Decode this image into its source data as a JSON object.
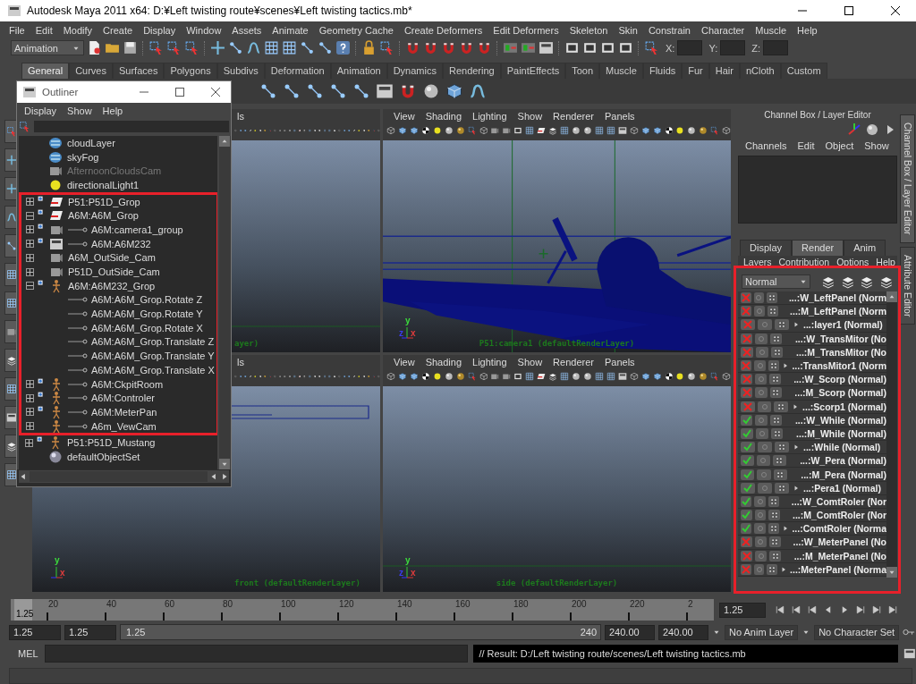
{
  "window": {
    "title": "Autodesk Maya 2011 x64: D:¥Left twisting route¥scenes¥Left twisting tactics.mb*"
  },
  "menu_bar": [
    "File",
    "Edit",
    "Modify",
    "Create",
    "Display",
    "Window",
    "Assets",
    "Animate",
    "Geometry Cache",
    "Create Deformers",
    "Edit Deformers",
    "Skeleton",
    "Skin",
    "Constrain",
    "Character",
    "Muscle",
    "Help"
  ],
  "status_line": {
    "mode": "Animation",
    "fields": [
      {
        "label": "X:"
      },
      {
        "label": "Y:"
      },
      {
        "label": "Z:"
      }
    ]
  },
  "shelf_tabs": [
    {
      "label": "General",
      "selected": true
    },
    {
      "label": "Curves",
      "selected": false
    },
    {
      "label": "Surfaces",
      "selected": false
    },
    {
      "label": "Polygons",
      "selected": false
    },
    {
      "label": "Subdivs",
      "selected": false
    },
    {
      "label": "Deformation",
      "selected": false
    },
    {
      "label": "Animation",
      "selected": false
    },
    {
      "label": "Dynamics",
      "selected": false
    },
    {
      "label": "Rendering",
      "selected": false
    },
    {
      "label": "PaintEffects",
      "selected": false
    },
    {
      "label": "Toon",
      "selected": false
    },
    {
      "label": "Muscle",
      "selected": false
    },
    {
      "label": "Fluids",
      "selected": false
    },
    {
      "label": "Fur",
      "selected": false
    },
    {
      "label": "Hair",
      "selected": false
    },
    {
      "label": "nCloth",
      "selected": false
    },
    {
      "label": "Custom",
      "selected": false
    }
  ],
  "viewports": [
    {
      "menus": [
        "ls"
      ],
      "label": "ayer)",
      "kind": "empty"
    },
    {
      "menus": [
        "View",
        "Shading",
        "Lighting",
        "Show",
        "Renderer",
        "Panels"
      ],
      "label": "P51:camera1 (defaultRenderLayer)",
      "kind": "airplane",
      "axes": [
        {
          "label": "y",
          "color": "#3cdc3c"
        },
        {
          "label": "z",
          "color": "#3c3cf0"
        },
        {
          "label": "x",
          "color": "#e03c3c"
        }
      ]
    },
    {
      "menus": [
        "ls"
      ],
      "label": "front (defaultRenderLayer)",
      "kind": "box",
      "axes": [
        {
          "label": "y",
          "color": "#3cdc3c"
        },
        {
          "label": "x",
          "color": "#e03c3c"
        }
      ]
    },
    {
      "menus": [
        "View",
        "Shading",
        "Lighting",
        "Show",
        "Renderer",
        "Panels"
      ],
      "label": "side (defaultRenderLayer)",
      "kind": "empty",
      "axes": [
        {
          "label": "y",
          "color": "#3cdc3c"
        },
        {
          "label": "z",
          "color": "#3c3cf0"
        },
        {
          "label": "x",
          "color": "#e03c3c"
        }
      ]
    }
  ],
  "outliner": {
    "title": "Outliner",
    "menus": [
      "Display",
      "Show",
      "Help"
    ],
    "items": [
      {
        "label": "cloudLayer",
        "kind": "fluid",
        "flagged": false,
        "dimmed": false
      },
      {
        "label": "skyFog",
        "kind": "fluid",
        "flagged": false,
        "dimmed": false
      },
      {
        "label": "AfternoonCloudsCam",
        "kind": "camera",
        "flagged": false,
        "dimmed": true
      },
      {
        "label": "directionalLight1",
        "kind": "light",
        "flagged": false,
        "dimmed": false
      },
      {
        "label": "P51:P51D_Grop",
        "kind": "transform",
        "expanded": false,
        "flagged": true,
        "dimmed": false
      },
      {
        "label": "A6M:A6M_Grop",
        "kind": "transform",
        "expanded": true,
        "flagged": true,
        "dimmed": false,
        "children": [
          {
            "label": "A6M:camera1_group",
            "kind": "camera",
            "expanded": false,
            "flagged": true,
            "dimmed": false
          },
          {
            "label": "A6M:A6M232",
            "kind": "panel",
            "expanded": false,
            "flagged": true,
            "dimmed": false
          }
        ]
      },
      {
        "label": "A6M_OutSide_Cam",
        "kind": "camera",
        "expanded": false,
        "flagged": false,
        "dimmed": false
      },
      {
        "label": "P51D_OutSide_Cam",
        "kind": "camera",
        "expanded": false,
        "flagged": false,
        "dimmed": false
      },
      {
        "label": "A6M:A6M232_Grop",
        "kind": "figure",
        "expanded": true,
        "flagged": true,
        "dimmed": false,
        "children": [
          {
            "label": "A6M:A6M_Grop.Rotate Z",
            "kind": "none",
            "flagged": false,
            "dimmed": false
          },
          {
            "label": "A6M:A6M_Grop.Rotate Y",
            "kind": "none",
            "flagged": false,
            "dimmed": false
          },
          {
            "label": "A6M:A6M_Grop.Rotate X",
            "kind": "none",
            "flagged": false,
            "dimmed": false
          },
          {
            "label": "A6M:A6M_Grop.Translate Z",
            "kind": "none",
            "flagged": false,
            "dimmed": false
          },
          {
            "label": "A6M:A6M_Grop.Translate Y",
            "kind": "none",
            "flagged": false,
            "dimmed": false
          },
          {
            "label": "A6M:A6M_Grop.Translate X",
            "kind": "none",
            "flagged": false,
            "dimmed": false
          },
          {
            "label": "A6M:CkpitRoom",
            "kind": "figure",
            "expanded": false,
            "flagged": true,
            "dimmed": false
          },
          {
            "label": "A6M:Controler",
            "kind": "figure",
            "expanded": false,
            "flagged": true,
            "dimmed": false
          },
          {
            "label": "A6M:MeterPan",
            "kind": "figure",
            "expanded": false,
            "flagged": true,
            "dimmed": false
          },
          {
            "label": "A6m_VewCam",
            "kind": "figure",
            "expanded": false,
            "flagged": false,
            "dimmed": false
          }
        ]
      },
      {
        "label": "P51:P51D_Mustang",
        "kind": "figure",
        "expanded": false,
        "flagged": true,
        "dimmed": false
      },
      {
        "label": "defaultObjectSet",
        "kind": "set",
        "flagged": false,
        "dimmed": false
      }
    ]
  },
  "channel_box": {
    "title": "Channel Box / Layer Editor",
    "menus": [
      "Channels",
      "Edit",
      "Object",
      "Show"
    ],
    "tabs": [
      {
        "label": "Display",
        "selected": false
      },
      {
        "label": "Render",
        "selected": true
      },
      {
        "label": "Anim",
        "selected": false
      }
    ],
    "layer_menus": [
      "Layers",
      "Contribution",
      "Options",
      "Help"
    ],
    "blend_mode": "Normal",
    "layers": [
      {
        "name": "...:W_LeftPanel (Norm",
        "renderable": false,
        "expandable": false
      },
      {
        "name": "...:M_LeftPanel (Norm",
        "renderable": false,
        "expandable": false
      },
      {
        "name": "...:layer1 (Normal)",
        "renderable": false,
        "expandable": true
      },
      {
        "name": "...:W_TransMitor (No",
        "renderable": false,
        "expandable": false
      },
      {
        "name": "...:M_TransMitor (No",
        "renderable": false,
        "expandable": false
      },
      {
        "name": "...:TransMitor1 (Norm",
        "renderable": false,
        "expandable": true
      },
      {
        "name": "...:W_Scorp (Normal)",
        "renderable": false,
        "expandable": false
      },
      {
        "name": "...:M_Scorp (Normal)",
        "renderable": false,
        "expandable": false
      },
      {
        "name": "...:Scorp1 (Normal)",
        "renderable": false,
        "expandable": true
      },
      {
        "name": "...:W_While (Normal)",
        "renderable": true,
        "expandable": false
      },
      {
        "name": "...:M_While (Normal)",
        "renderable": true,
        "expandable": false
      },
      {
        "name": "...:While (Normal)",
        "renderable": true,
        "expandable": true
      },
      {
        "name": "...:W_Pera (Normal)",
        "renderable": true,
        "expandable": false
      },
      {
        "name": "...:M_Pera (Normal)",
        "renderable": true,
        "expandable": false
      },
      {
        "name": "...:Pera1 (Normal)",
        "renderable": true,
        "expandable": true
      },
      {
        "name": "...:W_ComtRoler (Nor",
        "renderable": true,
        "expandable": false
      },
      {
        "name": "...:M_ComtRoler (Nor",
        "renderable": true,
        "expandable": false
      },
      {
        "name": "...:ComtRoler (Norma",
        "renderable": true,
        "expandable": true
      },
      {
        "name": "...:W_MeterPanel (No",
        "renderable": false,
        "expandable": false
      },
      {
        "name": "...:M_MeterPanel (No",
        "renderable": false,
        "expandable": false
      },
      {
        "name": "...:MeterPanel (Norma",
        "renderable": false,
        "expandable": true
      }
    ]
  },
  "side_tabs": [
    {
      "label": "Channel Box / Layer Editor",
      "selected": true
    },
    {
      "label": "Attribute Editor",
      "selected": false
    }
  ],
  "time_slider": {
    "current": "1.25",
    "level": 0.005,
    "ticks": [
      "20",
      "40",
      "60",
      "80",
      "100",
      "120",
      "140",
      "160",
      "180",
      "200",
      "220",
      "2"
    ],
    "time_field": "1.25"
  },
  "range_slider": {
    "start": "1.25",
    "range_start": "1.25",
    "bar_start": "1.25",
    "bar_end": "240",
    "range_end": "240.00",
    "end": "240.00",
    "anim_layer": "No Anim Layer",
    "character_set": "No Character Set"
  },
  "command_line": {
    "language": "MEL",
    "result": "// Result: D:/Left twisting route/scenes/Left twisting tactics.mb"
  }
}
